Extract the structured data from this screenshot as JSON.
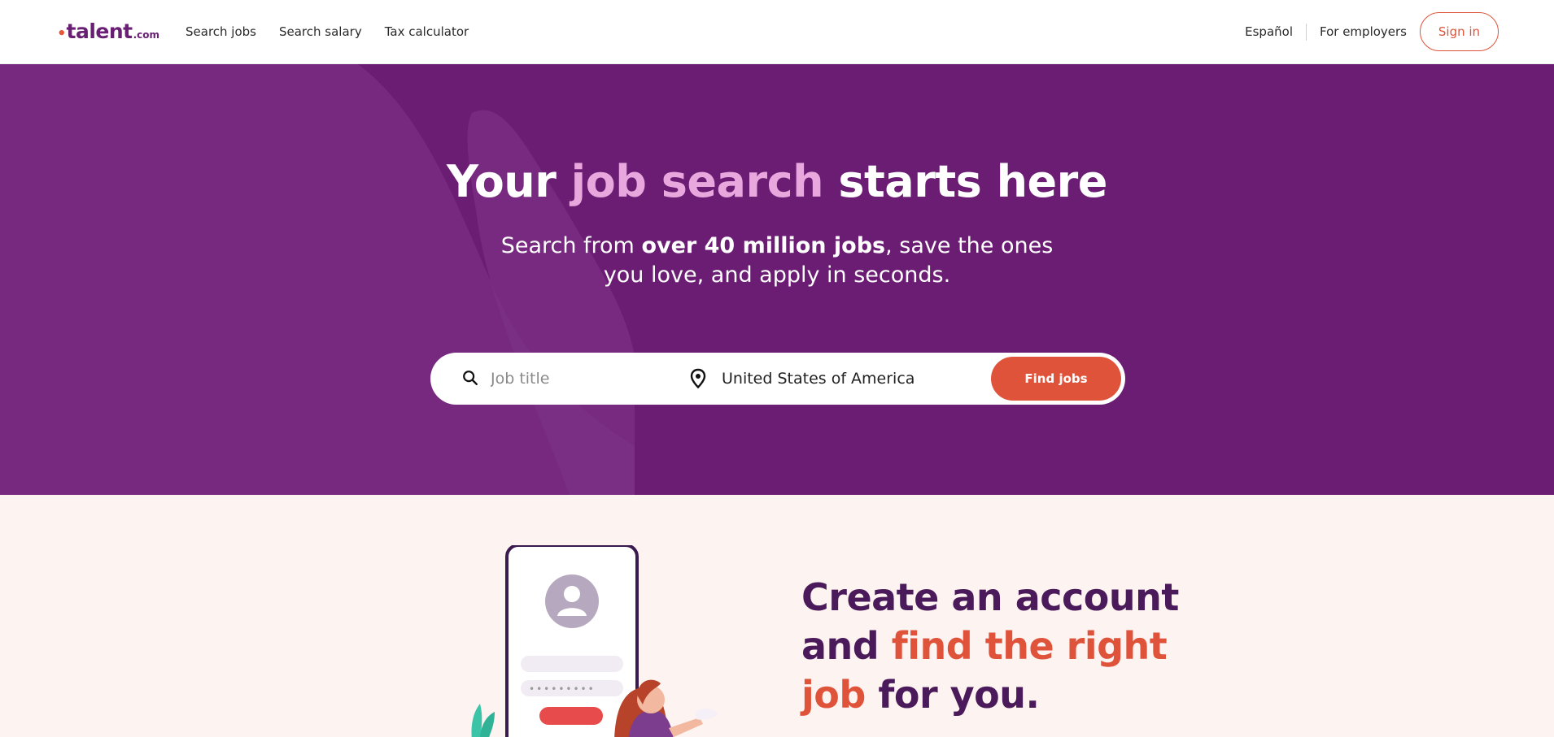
{
  "header": {
    "logo": {
      "word": "talent",
      "suffix": ".com"
    },
    "nav": [
      {
        "label": "Search jobs"
      },
      {
        "label": "Search salary"
      },
      {
        "label": "Tax calculator"
      }
    ],
    "language_label": "Español",
    "employers_label": "For employers",
    "signin_label": "Sign in"
  },
  "hero": {
    "headline": {
      "part1": "Your ",
      "highlight": "job search",
      "part2": " starts here"
    },
    "subtitle": {
      "part1": "Search from ",
      "bold": "over 40 million jobs",
      "part2": ", save the ones",
      "line2": "you love, and apply in seconds."
    },
    "search": {
      "job_placeholder": "Job title",
      "job_value": "",
      "location_value": "United States of America",
      "button_label": "Find jobs"
    }
  },
  "promo": {
    "line1": "Create an account",
    "line2_a": "and ",
    "line2_b": "find the right",
    "line3_a": "job",
    "line3_b": " for you."
  },
  "colors": {
    "brand_purple": "#6b1d74",
    "accent_orange": "#e0533b",
    "highlight_pink": "#e8a7dd",
    "page_bg": "#fdf3f0"
  },
  "icons": {
    "search": "search-icon",
    "location": "location-pin-icon"
  }
}
